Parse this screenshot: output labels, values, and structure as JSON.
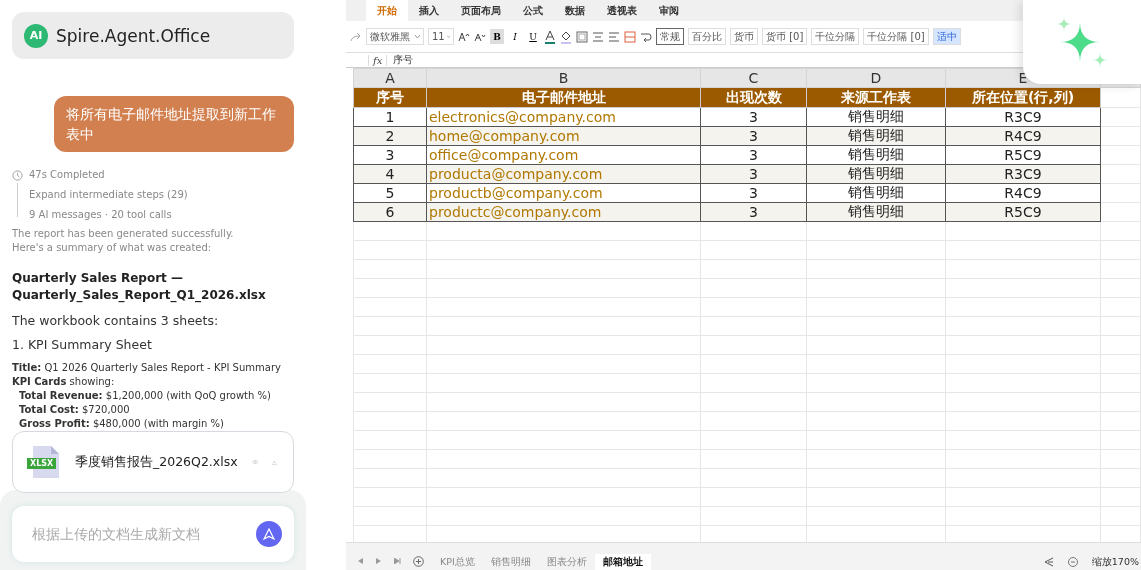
{
  "assistant": {
    "app_name": "Spire.Agent.Office",
    "logo": "AI",
    "user_message": "将所有电子邮件地址提取到新工作表中",
    "status": {
      "completed": "47s Completed",
      "expand": "Expand intermediate steps (29)",
      "counts": "9 AI messages · 20 tool calls"
    },
    "intro": "The report has been generated successfully.\nHere's a summary of what was created:",
    "heading": "Quarterly Sales Report — Quarterly_Sales_Report_Q1_2026.xlsx",
    "workbook_line": "The workbook contains 3 sheets:",
    "section": "1. KPI Summary Sheet",
    "details": [
      "**Title:** Q1 2026 Quarterly Sales Report - KPI Summary",
      "**KPI Cards** showing:"
    ],
    "bullets": [
      "**Total Revenue:** $1,200,000 (with QoQ growth %)",
      "**Total Cost:** $720,000",
      "**Gross Profit:** $480,000 (with margin %)"
    ],
    "attachment": {
      "badge": "XLSX",
      "name": "季度销售报告_2026Q2.xlsx"
    },
    "input": {
      "placeholder": "根据上传的文档生成新文档"
    }
  },
  "spreadsheet": {
    "ribbon_tabs": [
      {
        "label": "开始",
        "selected": true
      },
      {
        "label": "插入",
        "selected": false
      },
      {
        "label": "页面布局",
        "selected": false
      },
      {
        "label": "公式",
        "selected": false
      },
      {
        "label": "数据",
        "selected": false
      },
      {
        "label": "透视表",
        "selected": false
      },
      {
        "label": "审阅",
        "selected": false
      }
    ],
    "font": "微软雅黑",
    "font_size": "11",
    "format_buttons": [
      {
        "label": "B",
        "selected": true
      },
      {
        "label": "I",
        "selected": false
      },
      {
        "label": "U",
        "selected": false
      }
    ],
    "styles": [
      {
        "label": "常规",
        "selected": true,
        "color": "#ffffff"
      },
      {
        "label": "百分比",
        "selected": false,
        "color": "#ffffff"
      },
      {
        "label": "货币",
        "selected": false,
        "color": "#ffffff"
      },
      {
        "label": "货币 [0]",
        "selected": false,
        "color": "#ffffff"
      },
      {
        "label": "千位分隔",
        "selected": false,
        "color": "#ffffff"
      },
      {
        "label": "千位分隔 [0]",
        "selected": false,
        "color": "#ffffff"
      },
      {
        "label": "适中",
        "selected": false,
        "color": "#d6e6ff"
      }
    ],
    "formula_label": "fx",
    "formula": "序号",
    "columns": [
      "A",
      "B",
      "C",
      "D",
      "E"
    ],
    "header": [
      "序号",
      "电子邮件地址",
      "出现次数",
      "来源工作表",
      "所在位置(行,列)"
    ],
    "rows": [
      [
        "1",
        "electronics@company.com",
        "3",
        "销售明细",
        "R3C9"
      ],
      [
        "2",
        "home@company.com",
        "3",
        "销售明细",
        "R4C9"
      ],
      [
        "3",
        "office@company.com",
        "3",
        "销售明细",
        "R5C9"
      ],
      [
        "4",
        "producta@company.com",
        "3",
        "销售明细",
        "R3C9"
      ],
      [
        "5",
        "productb@company.com",
        "3",
        "销售明细",
        "R4C9"
      ],
      [
        "6",
        "productc@company.com",
        "3",
        "销售明细",
        "R5C9"
      ]
    ],
    "sheet_tabs": [
      {
        "label": "KPI总览",
        "selected": false
      },
      {
        "label": "销售明细",
        "selected": false
      },
      {
        "label": "图表分析",
        "selected": false
      },
      {
        "label": "邮箱地址",
        "selected": true
      }
    ],
    "zoom": "缩放170%"
  }
}
